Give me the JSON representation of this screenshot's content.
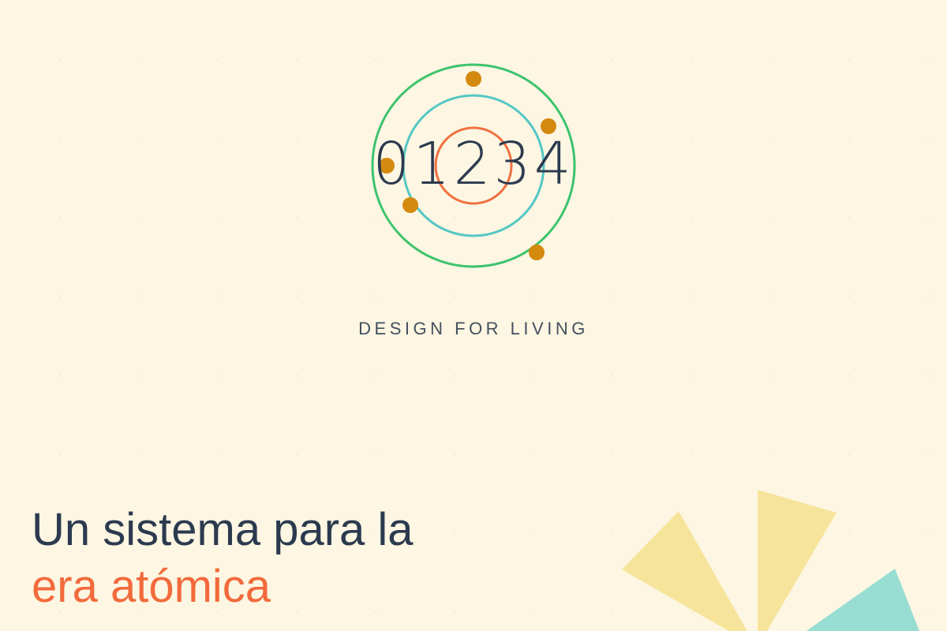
{
  "logo": {
    "number": "01234",
    "colors": {
      "outer_ring": "#3cc36c",
      "middle_ring": "#55c7c4",
      "inner_ring": "#f07140",
      "electrons": "#d4890f",
      "number": "#2c3a4f"
    }
  },
  "tagline": "DESIGN FOR LIVING",
  "hero": {
    "line1": "Un sistema para la",
    "line2": "era atómica",
    "colors": {
      "line1": "#2c3a4f",
      "line2": "#f26a3c"
    }
  },
  "decor": {
    "colors": {
      "wedge_yellow": "#f6e49a",
      "wedge_teal": "#97ddd2"
    }
  },
  "background": "#fcf6e2"
}
